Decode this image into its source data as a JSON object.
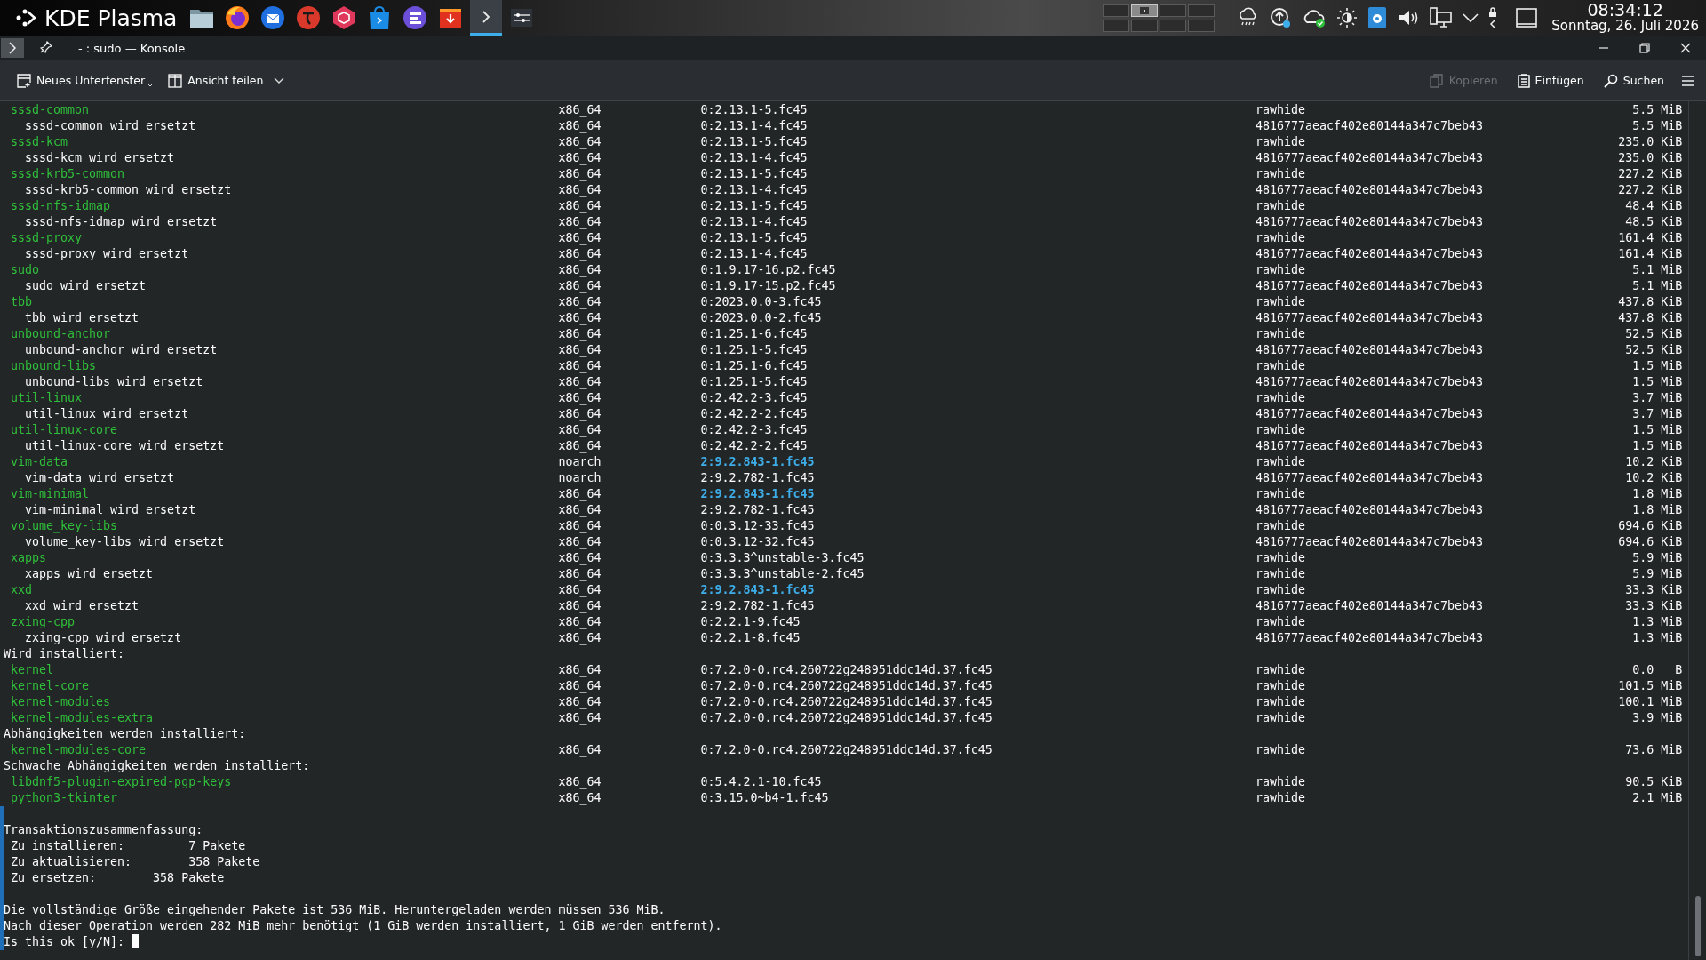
{
  "taskbar": {
    "launcher": {
      "label": "KDE Plasma"
    },
    "apps": [
      {
        "selected": false
      },
      {
        "selected": false
      },
      {
        "selected": false
      },
      {
        "selected": false
      },
      {
        "selected": false
      },
      {
        "selected": false
      },
      {
        "selected": false
      },
      {
        "selected": false
      },
      {
        "selected": true
      },
      {
        "selected": false
      }
    ],
    "pager": {
      "desktops": [
        {
          "selected": false
        },
        {
          "selected": true
        },
        {
          "selected": false
        },
        {
          "selected": false
        },
        {
          "selected": false
        },
        {
          "selected": false
        },
        {
          "selected": false
        },
        {
          "selected": false
        }
      ]
    },
    "clock": {
      "time": "08:34:12",
      "date": "Sonntag, 26. Juli 2026"
    }
  },
  "window": {
    "title": "- : sudo — Konsole"
  },
  "toolbar": {
    "left": [
      {
        "label": "Neues Unterfenster",
        "disabled": false
      },
      {
        "label": "Ansicht teilen",
        "disabled": false
      }
    ],
    "right": [
      {
        "label": "Kopieren",
        "disabled": true
      },
      {
        "label": "Einfügen",
        "disabled": false
      },
      {
        "label": "Suchen",
        "disabled": false
      }
    ]
  },
  "terminal": {
    "lines": [
      {
        "kind": "package",
        "name": "sssd-common",
        "arch": "x86_64",
        "version": "0:2.13.1-5.fc45",
        "repo": "rawhide",
        "size": "5.5 MiB",
        "version_highlighted": false
      },
      {
        "kind": "replaced",
        "name": "sssd-common wird ersetzt",
        "arch": "x86_64",
        "version": "0:2.13.1-4.fc45",
        "repo": "4816777aeacf402e80144a347c7beb43",
        "size": "5.5 MiB",
        "version_highlighted": false
      },
      {
        "kind": "package",
        "name": "sssd-kcm",
        "arch": "x86_64",
        "version": "0:2.13.1-5.fc45",
        "repo": "rawhide",
        "size": "235.0 KiB",
        "version_highlighted": false
      },
      {
        "kind": "replaced",
        "name": "sssd-kcm wird ersetzt",
        "arch": "x86_64",
        "version": "0:2.13.1-4.fc45",
        "repo": "4816777aeacf402e80144a347c7beb43",
        "size": "235.0 KiB",
        "version_highlighted": false
      },
      {
        "kind": "package",
        "name": "sssd-krb5-common",
        "arch": "x86_64",
        "version": "0:2.13.1-5.fc45",
        "repo": "rawhide",
        "size": "227.2 KiB",
        "version_highlighted": false
      },
      {
        "kind": "replaced",
        "name": "sssd-krb5-common wird ersetzt",
        "arch": "x86_64",
        "version": "0:2.13.1-4.fc45",
        "repo": "4816777aeacf402e80144a347c7beb43",
        "size": "227.2 KiB",
        "version_highlighted": false
      },
      {
        "kind": "package",
        "name": "sssd-nfs-idmap",
        "arch": "x86_64",
        "version": "0:2.13.1-5.fc45",
        "repo": "rawhide",
        "size": "48.4 KiB",
        "version_highlighted": false
      },
      {
        "kind": "replaced",
        "name": "sssd-nfs-idmap wird ersetzt",
        "arch": "x86_64",
        "version": "0:2.13.1-4.fc45",
        "repo": "4816777aeacf402e80144a347c7beb43",
        "size": "48.5 KiB",
        "version_highlighted": false
      },
      {
        "kind": "package",
        "name": "sssd-proxy",
        "arch": "x86_64",
        "version": "0:2.13.1-5.fc45",
        "repo": "rawhide",
        "size": "161.4 KiB",
        "version_highlighted": false
      },
      {
        "kind": "replaced",
        "name": "sssd-proxy wird ersetzt",
        "arch": "x86_64",
        "version": "0:2.13.1-4.fc45",
        "repo": "4816777aeacf402e80144a347c7beb43",
        "size": "161.4 KiB",
        "version_highlighted": false
      },
      {
        "kind": "package",
        "name": "sudo",
        "arch": "x86_64",
        "version": "0:1.9.17-16.p2.fc45",
        "repo": "rawhide",
        "size": "5.1 MiB",
        "version_highlighted": false
      },
      {
        "kind": "replaced",
        "name": "sudo wird ersetzt",
        "arch": "x86_64",
        "version": "0:1.9.17-15.p2.fc45",
        "repo": "4816777aeacf402e80144a347c7beb43",
        "size": "5.1 MiB",
        "version_highlighted": false
      },
      {
        "kind": "package",
        "name": "tbb",
        "arch": "x86_64",
        "version": "0:2023.0.0-3.fc45",
        "repo": "rawhide",
        "size": "437.8 KiB",
        "version_highlighted": false
      },
      {
        "kind": "replaced",
        "name": "tbb wird ersetzt",
        "arch": "x86_64",
        "version": "0:2023.0.0-2.fc45",
        "repo": "4816777aeacf402e80144a347c7beb43",
        "size": "437.8 KiB",
        "version_highlighted": false
      },
      {
        "kind": "package",
        "name": "unbound-anchor",
        "arch": "x86_64",
        "version": "0:1.25.1-6.fc45",
        "repo": "rawhide",
        "size": "52.5 KiB",
        "version_highlighted": false
      },
      {
        "kind": "replaced",
        "name": "unbound-anchor wird ersetzt",
        "arch": "x86_64",
        "version": "0:1.25.1-5.fc45",
        "repo": "4816777aeacf402e80144a347c7beb43",
        "size": "52.5 KiB",
        "version_highlighted": false
      },
      {
        "kind": "package",
        "name": "unbound-libs",
        "arch": "x86_64",
        "version": "0:1.25.1-6.fc45",
        "repo": "rawhide",
        "size": "1.5 MiB",
        "version_highlighted": false
      },
      {
        "kind": "replaced",
        "name": "unbound-libs wird ersetzt",
        "arch": "x86_64",
        "version": "0:1.25.1-5.fc45",
        "repo": "4816777aeacf402e80144a347c7beb43",
        "size": "1.5 MiB",
        "version_highlighted": false
      },
      {
        "kind": "package",
        "name": "util-linux",
        "arch": "x86_64",
        "version": "0:2.42.2-3.fc45",
        "repo": "rawhide",
        "size": "3.7 MiB",
        "version_highlighted": false
      },
      {
        "kind": "replaced",
        "name": "util-linux wird ersetzt",
        "arch": "x86_64",
        "version": "0:2.42.2-2.fc45",
        "repo": "4816777aeacf402e80144a347c7beb43",
        "size": "3.7 MiB",
        "version_highlighted": false
      },
      {
        "kind": "package",
        "name": "util-linux-core",
        "arch": "x86_64",
        "version": "0:2.42.2-3.fc45",
        "repo": "rawhide",
        "size": "1.5 MiB",
        "version_highlighted": false
      },
      {
        "kind": "replaced",
        "name": "util-linux-core wird ersetzt",
        "arch": "x86_64",
        "version": "0:2.42.2-2.fc45",
        "repo": "4816777aeacf402e80144a347c7beb43",
        "size": "1.5 MiB",
        "version_highlighted": false
      },
      {
        "kind": "package",
        "name": "vim-data",
        "arch": "noarch",
        "version": "2:9.2.843-1.fc45",
        "repo": "rawhide",
        "size": "10.2 KiB",
        "version_highlighted": true
      },
      {
        "kind": "replaced",
        "name": "vim-data wird ersetzt",
        "arch": "noarch",
        "version": "2:9.2.782-1.fc45",
        "repo": "4816777aeacf402e80144a347c7beb43",
        "size": "10.2 KiB",
        "version_highlighted": false
      },
      {
        "kind": "package",
        "name": "vim-minimal",
        "arch": "x86_64",
        "version": "2:9.2.843-1.fc45",
        "repo": "rawhide",
        "size": "1.8 MiB",
        "version_highlighted": true
      },
      {
        "kind": "replaced",
        "name": "vim-minimal wird ersetzt",
        "arch": "x86_64",
        "version": "2:9.2.782-1.fc45",
        "repo": "4816777aeacf402e80144a347c7beb43",
        "size": "1.8 MiB",
        "version_highlighted": false
      },
      {
        "kind": "package",
        "name": "volume_key-libs",
        "arch": "x86_64",
        "version": "0:0.3.12-33.fc45",
        "repo": "rawhide",
        "size": "694.6 KiB",
        "version_highlighted": false
      },
      {
        "kind": "replaced",
        "name": "volume_key-libs wird ersetzt",
        "arch": "x86_64",
        "version": "0:0.3.12-32.fc45",
        "repo": "4816777aeacf402e80144a347c7beb43",
        "size": "694.6 KiB",
        "version_highlighted": false
      },
      {
        "kind": "package",
        "name": "xapps",
        "arch": "x86_64",
        "version": "0:3.3.3^unstable-3.fc45",
        "repo": "rawhide",
        "size": "5.9 MiB",
        "version_highlighted": false
      },
      {
        "kind": "replaced",
        "name": "xapps wird ersetzt",
        "arch": "x86_64",
        "version": "0:3.3.3^unstable-2.fc45",
        "repo": "rawhide",
        "size": "5.9 MiB",
        "version_highlighted": false
      },
      {
        "kind": "package",
        "name": "xxd",
        "arch": "x86_64",
        "version": "2:9.2.843-1.fc45",
        "repo": "rawhide",
        "size": "33.3 KiB",
        "version_highlighted": true
      },
      {
        "kind": "replaced",
        "name": "xxd wird ersetzt",
        "arch": "x86_64",
        "version": "2:9.2.782-1.fc45",
        "repo": "4816777aeacf402e80144a347c7beb43",
        "size": "33.3 KiB",
        "version_highlighted": false
      },
      {
        "kind": "package",
        "name": "zxing-cpp",
        "arch": "x86_64",
        "version": "0:2.2.1-9.fc45",
        "repo": "rawhide",
        "size": "1.3 MiB",
        "version_highlighted": false
      },
      {
        "kind": "replaced",
        "name": "zxing-cpp wird ersetzt",
        "arch": "x86_64",
        "version": "0:2.2.1-8.fc45",
        "repo": "4816777aeacf402e80144a347c7beb43",
        "size": "1.3 MiB",
        "version_highlighted": false
      },
      {
        "kind": "heading",
        "text": "Wird installiert:"
      },
      {
        "kind": "package",
        "name": "kernel",
        "arch": "x86_64",
        "version": "0:7.2.0-0.rc4.260722g248951ddc14d.37.fc45",
        "repo": "rawhide",
        "size": "0.0   B",
        "version_highlighted": false
      },
      {
        "kind": "package",
        "name": "kernel-core",
        "arch": "x86_64",
        "version": "0:7.2.0-0.rc4.260722g248951ddc14d.37.fc45",
        "repo": "rawhide",
        "size": "101.5 MiB",
        "version_highlighted": false
      },
      {
        "kind": "package",
        "name": "kernel-modules",
        "arch": "x86_64",
        "version": "0:7.2.0-0.rc4.260722g248951ddc14d.37.fc45",
        "repo": "rawhide",
        "size": "100.1 MiB",
        "version_highlighted": false
      },
      {
        "kind": "package",
        "name": "kernel-modules-extra",
        "arch": "x86_64",
        "version": "0:7.2.0-0.rc4.260722g248951ddc14d.37.fc45",
        "repo": "rawhide",
        "size": "3.9 MiB",
        "version_highlighted": false
      },
      {
        "kind": "heading",
        "text": "Abhängigkeiten werden installiert:"
      },
      {
        "kind": "package",
        "name": "kernel-modules-core",
        "arch": "x86_64",
        "version": "0:7.2.0-0.rc4.260722g248951ddc14d.37.fc45",
        "repo": "rawhide",
        "size": "73.6 MiB",
        "version_highlighted": false
      },
      {
        "kind": "heading",
        "text": "Schwache Abhängigkeiten werden installiert:"
      },
      {
        "kind": "package",
        "name": "libdnf5-plugin-expired-pgp-keys",
        "arch": "x86_64",
        "version": "0:5.4.2.1-10.fc45",
        "repo": "rawhide",
        "size": "90.5 KiB",
        "version_highlighted": false
      },
      {
        "kind": "package",
        "name": "python3-tkinter",
        "arch": "x86_64",
        "version": "0:3.15.0~b4-1.fc45",
        "repo": "rawhide",
        "size": "2.1 MiB",
        "version_highlighted": false
      }
    ],
    "marked_lines": [
      {
        "kind": "blank"
      },
      {
        "kind": "heading",
        "text": "Transaktionszusammenfassung:"
      },
      {
        "kind": "summary",
        "text": "Zu installieren:         7 Pakete"
      },
      {
        "kind": "summary",
        "text": "Zu aktualisieren:        358 Pakete"
      },
      {
        "kind": "summary",
        "text": "Zu ersetzen:        358 Pakete"
      },
      {
        "kind": "blank"
      },
      {
        "kind": "heading",
        "text": "Die vollständige Größe eingehender Pakete ist 536 MiB. Heruntergeladen werden müssen 536 MiB."
      },
      {
        "kind": "heading",
        "text": "Nach dieser Operation werden 282 MiB mehr benötigt (1 GiB werden installiert, 1 GiB werden entfernt)."
      },
      {
        "kind": "prompt",
        "text": "Is this ok [y/N]: "
      }
    ]
  }
}
